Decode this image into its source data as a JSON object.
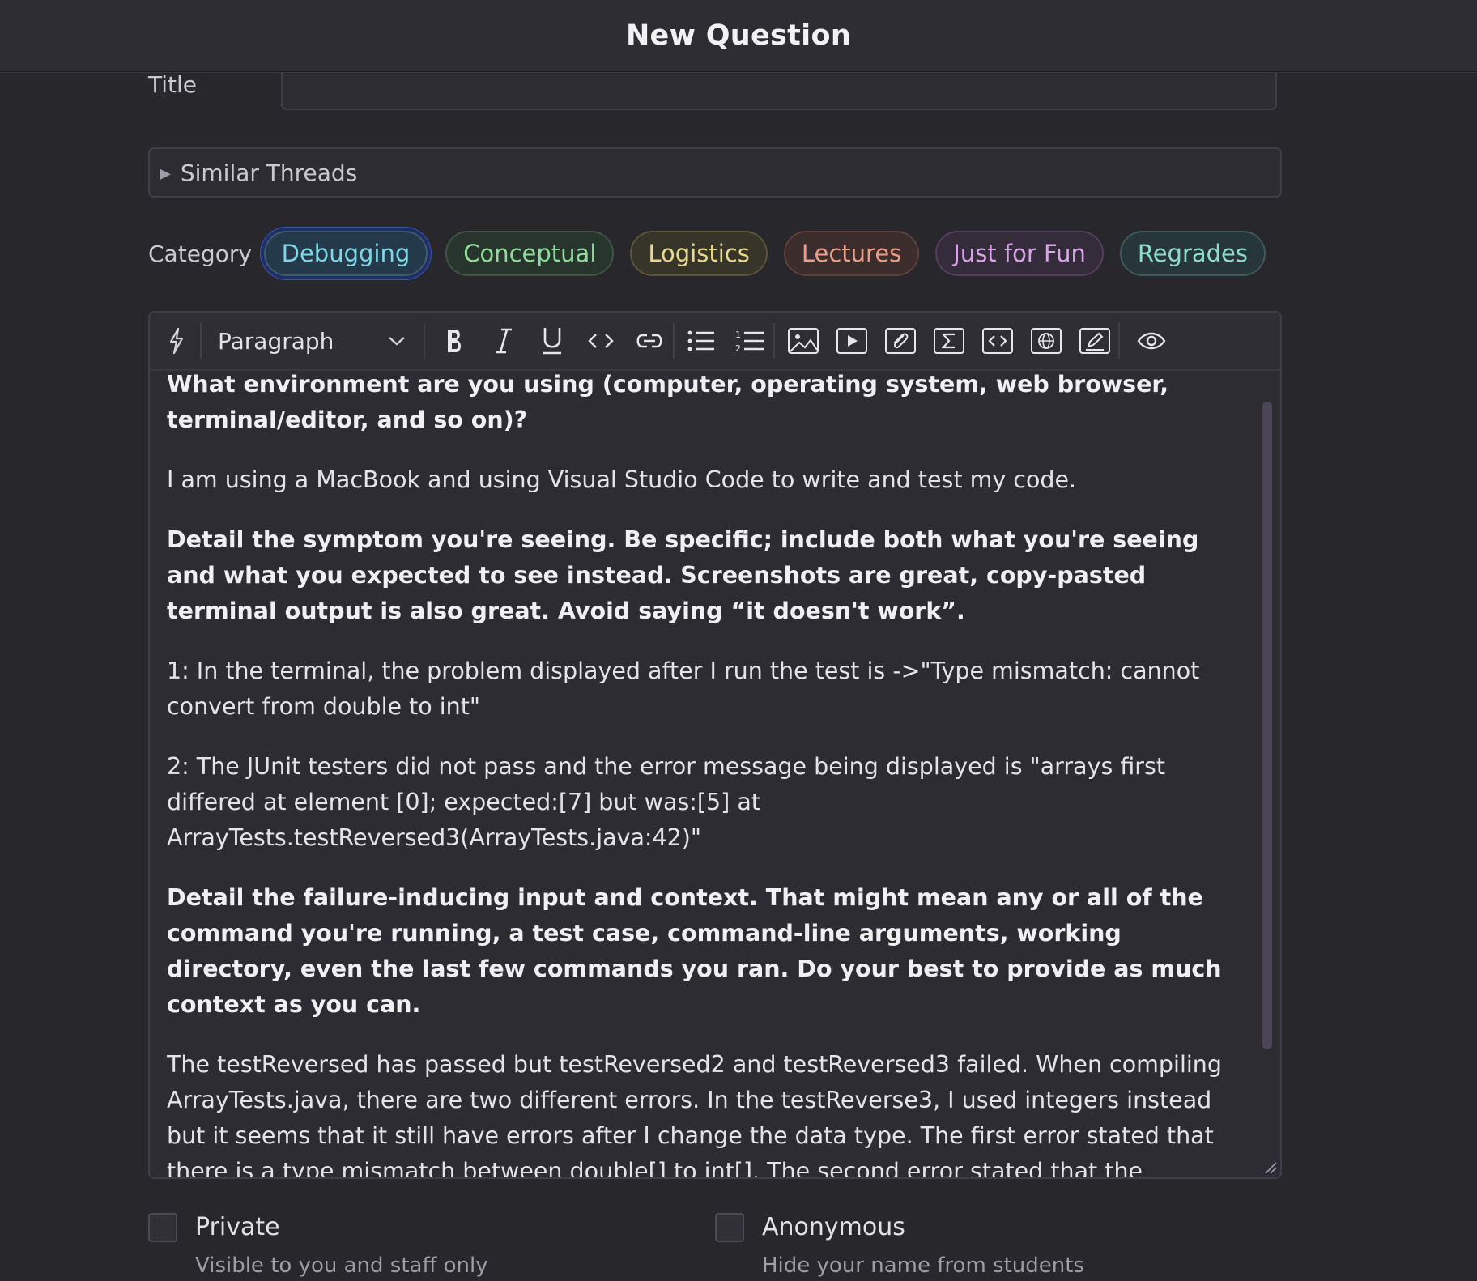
{
  "header": {
    "title": "New Question"
  },
  "form": {
    "title_label": "Title",
    "title_value": "",
    "similar_label": "Similar Threads",
    "category_label": "Category",
    "categories": [
      {
        "label": "Debugging"
      },
      {
        "label": "Conceptual"
      },
      {
        "label": "Logistics"
      },
      {
        "label": "Lectures"
      },
      {
        "label": "Just for Fun"
      },
      {
        "label": "Regrades"
      }
    ]
  },
  "toolbar": {
    "paragraph_label": "Paragraph",
    "icons": [
      "lightning-icon",
      "chevron-down-icon",
      "bold-icon",
      "italic-icon",
      "underline-icon",
      "code-icon",
      "link-icon",
      "bullet-list-icon",
      "numbered-list-icon",
      "image-icon",
      "video-icon",
      "attachment-icon",
      "math-icon",
      "code-block-icon",
      "web-snippet-icon",
      "draw-icon",
      "preview-eye-icon"
    ]
  },
  "content": {
    "paragraphs": [
      {
        "bold": true,
        "text": "What environment are you using (computer, operating system, web browser, terminal/editor, and so on)?"
      },
      {
        "bold": false,
        "text": "I am using a MacBook and using Visual Studio Code to write and test my code."
      },
      {
        "bold": true,
        "text": "Detail the symptom you're seeing. Be specific; include both what you're seeing and what you expected to see instead. Screenshots are great, copy-pasted terminal output is also great. Avoid saying “it doesn't work”."
      },
      {
        "bold": false,
        "text": "1: In the terminal, the problem displayed after I run the test is ->\"Type mismatch: cannot convert from double to int\""
      },
      {
        "bold": false,
        "text": "2: The JUnit testers did not pass and the error message being displayed is \"arrays first differed at element [0]; expected:[7] but was:[5] at ArrayTests.testReversed3(ArrayTests.java:42)\""
      },
      {
        "bold": true,
        "text": "Detail the failure-inducing input and context. That might mean any or all of the command you're running, a test case, command-line arguments, working directory, even the last few commands you ran. Do your best to provide as much context as you can."
      },
      {
        "bold": false,
        "text": "The testReversed has passed but testReversed2 and testReversed3  failed. When compiling ArrayTests.java, there are two different errors. In the testReverse3, I used integers instead but it seems that it still have errors after I change the data type. The first error stated that there is a type mismatch between double[] to int[]. The second error stated that the expected result was different from the actual result."
      }
    ]
  },
  "options": {
    "private_label": "Private",
    "private_sub": "Visible to you and staff only",
    "anonymous_label": "Anonymous",
    "anonymous_sub": "Hide your name from students"
  }
}
